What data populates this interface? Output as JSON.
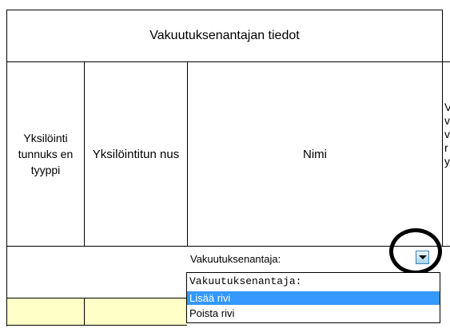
{
  "sheet": {
    "section_title": "Vakuutuksenantajan tiedot",
    "columns": [
      {
        "label": "Yksilöinti tunnuks en tyyppi"
      },
      {
        "label": "Yksilöintitun nus"
      },
      {
        "label": "Nimi"
      },
      {
        "label": "V v v r y"
      }
    ],
    "row_fill_color": "#ffffc8"
  },
  "combo": {
    "selected_value": "Vakuutuksenantaja:",
    "button_icon": "chevron-down-icon"
  },
  "dropdown": {
    "items": [
      {
        "label": "Vakuutuksenantaja:",
        "selected": false
      },
      {
        "label": "Lisää rivi",
        "selected": true
      },
      {
        "label": "Poista rivi",
        "selected": false
      }
    ],
    "highlight_color": "#3399ff"
  }
}
